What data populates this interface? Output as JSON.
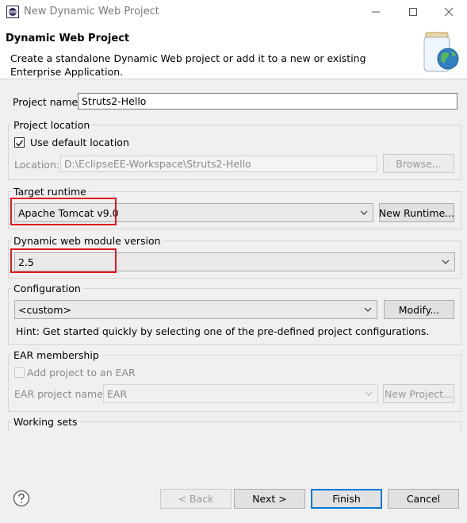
{
  "window": {
    "title": "New Dynamic Web Project",
    "controls": {
      "minimize_icon": "minimize-icon",
      "maximize_icon": "maximize-icon",
      "close_icon": "close-icon"
    }
  },
  "header": {
    "title": "Dynamic Web Project",
    "description": "Create a standalone Dynamic Web project or add it to a new or existing Enterprise Application.",
    "graphic": "jar-globe-icon"
  },
  "project_name": {
    "label": "Project name:",
    "value": "Struts2-Hello"
  },
  "project_location": {
    "group_title": "Project location",
    "use_default_label": "Use default location",
    "use_default_checked": true,
    "location_label": "Location:",
    "location_value": "D:\\EclipseEE-Workspace\\Struts2-Hello",
    "browse_label": "Browse..."
  },
  "target_runtime": {
    "group_title": "Target runtime",
    "selected": "Apache Tomcat v9.0",
    "new_runtime_label": "New Runtime..."
  },
  "module_version": {
    "group_title": "Dynamic web module version",
    "selected": "2.5"
  },
  "configuration": {
    "group_title": "Configuration",
    "selected": "<custom>",
    "modify_label": "Modify...",
    "hint": "Hint: Get started quickly by selecting one of the pre-defined project configurations."
  },
  "ear_membership": {
    "group_title": "EAR membership",
    "add_label": "Add project to an EAR",
    "add_checked": false,
    "project_name_label": "EAR project name:",
    "project_name_value": "EAR",
    "new_project_label": "New Project..."
  },
  "working_sets": {
    "group_title": "Working sets"
  },
  "footer": {
    "help_icon": "help-icon",
    "back_label": "< Back",
    "next_label": "Next >",
    "finish_label": "Finish",
    "cancel_label": "Cancel"
  },
  "colors": {
    "highlight": "#e0181e",
    "default_button": "#0078d7"
  }
}
